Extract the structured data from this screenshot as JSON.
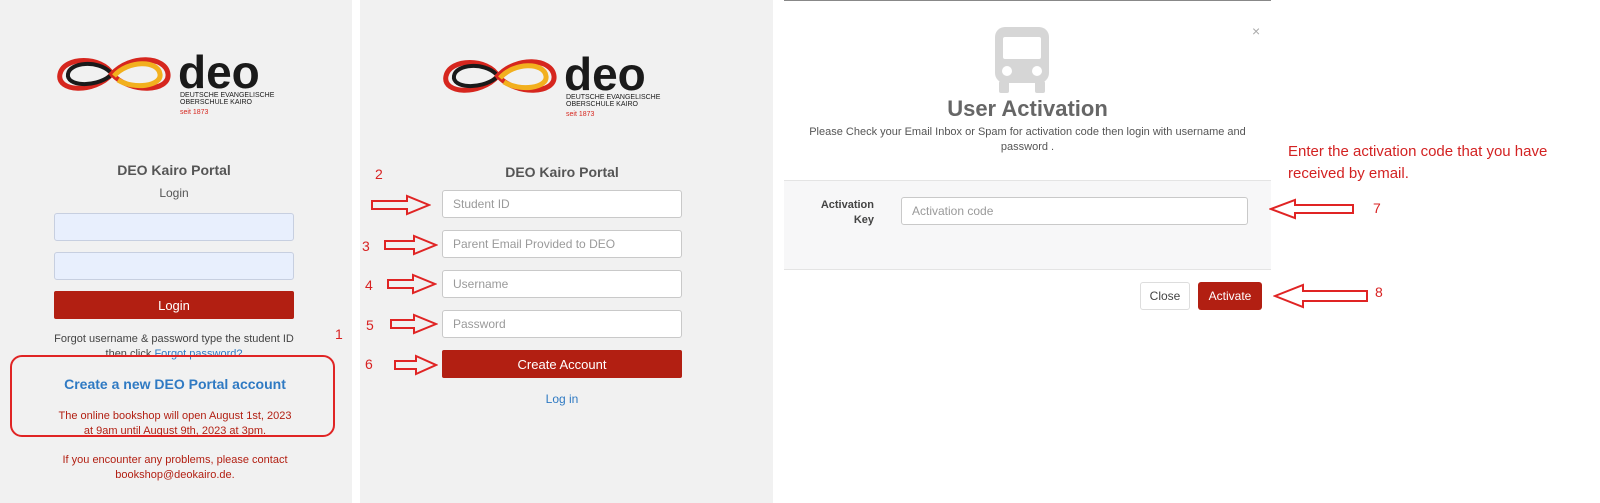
{
  "logo": {
    "wordmark": "deo",
    "line1": "DEUTSCHE EVANGELISCHE",
    "line2": "OBERSCHULE KAIRO",
    "since": "seit 1873",
    "colors": {
      "black": "#1a1a1a",
      "red": "#d6261e",
      "gold": "#f2b01e"
    }
  },
  "login_panel": {
    "title": "DEO Kairo Portal",
    "subtitle": "Login",
    "login_button": "Login",
    "forgot_text": "Forgot username & password type the student ID",
    "forgot_then": "then click",
    "forgot_link": "Forgot password?",
    "create_link": "Create a new DEO Portal account",
    "bookshop_text_1": "The online bookshop will open August 1st, 2023",
    "bookshop_text_2": "at 9am until August 9th, 2023 at 3pm.",
    "problems_text_1": "If you encounter any problems, please contact",
    "problems_text_2": "bookshop@deokairo.de."
  },
  "register_panel": {
    "title": "DEO Kairo Portal",
    "student_id_placeholder": "Student ID",
    "parent_email_placeholder": "Parent Email Provided to DEO",
    "username_placeholder": "Username",
    "password_placeholder": "Password",
    "create_button": "Create Account",
    "login_link": "Log in"
  },
  "modal": {
    "title": "User Activation",
    "close_glyph": "×",
    "desc_line1": "Please Check your Email Inbox or Spam for activation code then login with username and",
    "desc_line2": "password .",
    "activation_label_1": "Activation",
    "activation_label_2": "Key",
    "activation_placeholder": "Activation code",
    "close_button": "Close",
    "activate_button": "Activate",
    "icon": "bus-icon"
  },
  "annotations": {
    "n1": "1",
    "n2": "2",
    "n3": "3",
    "n4": "4",
    "n5": "5",
    "n6": "6",
    "n7": "7",
    "n8": "8",
    "instruction_1": "Enter the activation code that you have",
    "instruction_2": "received by email.",
    "color": "#e02424"
  }
}
